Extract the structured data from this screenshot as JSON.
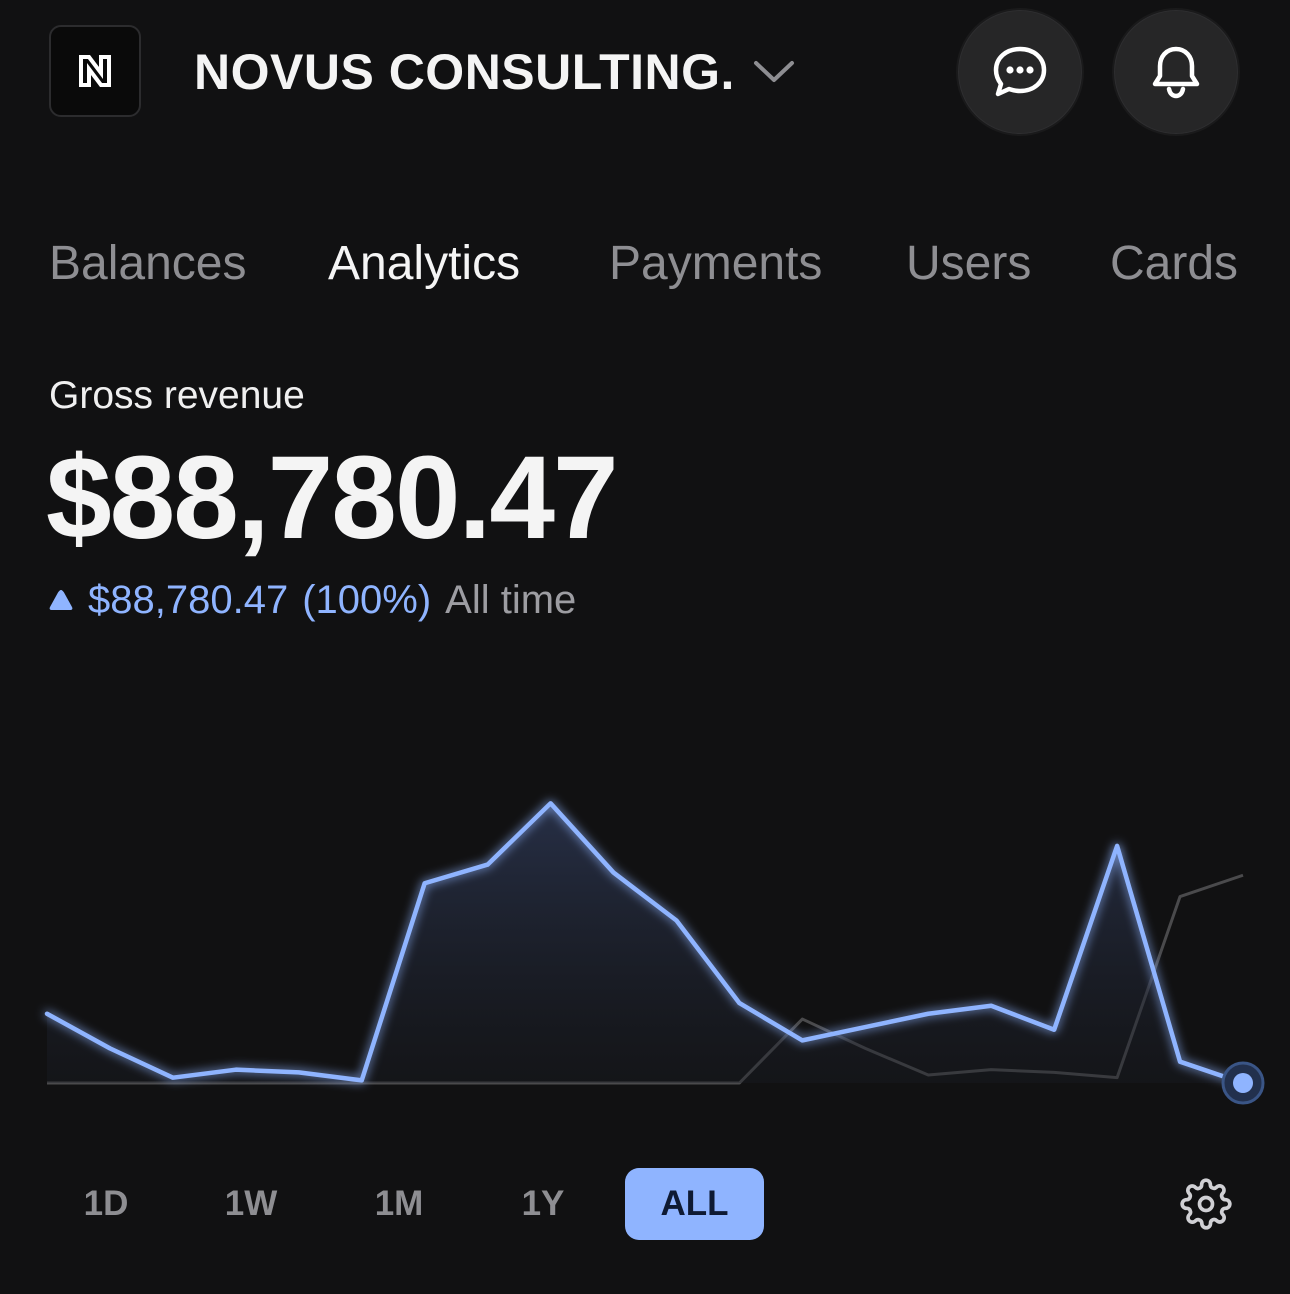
{
  "header": {
    "company_name": "NOVUS CONSULTING.",
    "logo_icon": "novus-logo-icon",
    "chat_icon": "chat-bubble-icon",
    "bell_icon": "bell-icon"
  },
  "tabs": [
    {
      "label": "Balances",
      "active": false
    },
    {
      "label": "Analytics",
      "active": true
    },
    {
      "label": "Payments",
      "active": false
    },
    {
      "label": "Users",
      "active": false
    },
    {
      "label": "Cards",
      "active": false
    }
  ],
  "revenue": {
    "label": "Gross revenue",
    "amount": "$88,780.47",
    "change_amount": "$88,780.47",
    "change_percent": "(100%)",
    "period": "All time"
  },
  "colors": {
    "background": "#111112",
    "accent": "#8fb4ff",
    "comparison_line": "#4a4a4c",
    "muted_text": "#8e8e92"
  },
  "chart_data": {
    "type": "area",
    "x": [
      0,
      1,
      2,
      3,
      4,
      5,
      6,
      7,
      8,
      9,
      10,
      11,
      12,
      13,
      14,
      15,
      16,
      17,
      18,
      19
    ],
    "series": [
      {
        "values": [
          26,
          13,
          2,
          5,
          4,
          1,
          75,
          82,
          105,
          79,
          61,
          30,
          16,
          21,
          26,
          29,
          20,
          89,
          8,
          0
        ],
        "highlight_last": true
      },
      {
        "values": [
          0,
          0,
          0,
          0,
          0,
          0,
          0,
          0,
          0,
          0,
          0,
          0,
          24,
          13,
          3,
          5,
          4,
          2,
          70,
          78
        ]
      }
    ],
    "ylim": [
      0,
      110
    ],
    "grid": false,
    "legend": "none"
  },
  "ranges": [
    {
      "label": "1D",
      "active": false
    },
    {
      "label": "1W",
      "active": false
    },
    {
      "label": "1M",
      "active": false
    },
    {
      "label": "1Y",
      "active": false
    },
    {
      "label": "ALL",
      "active": true
    }
  ],
  "settings_icon": "gear-icon"
}
